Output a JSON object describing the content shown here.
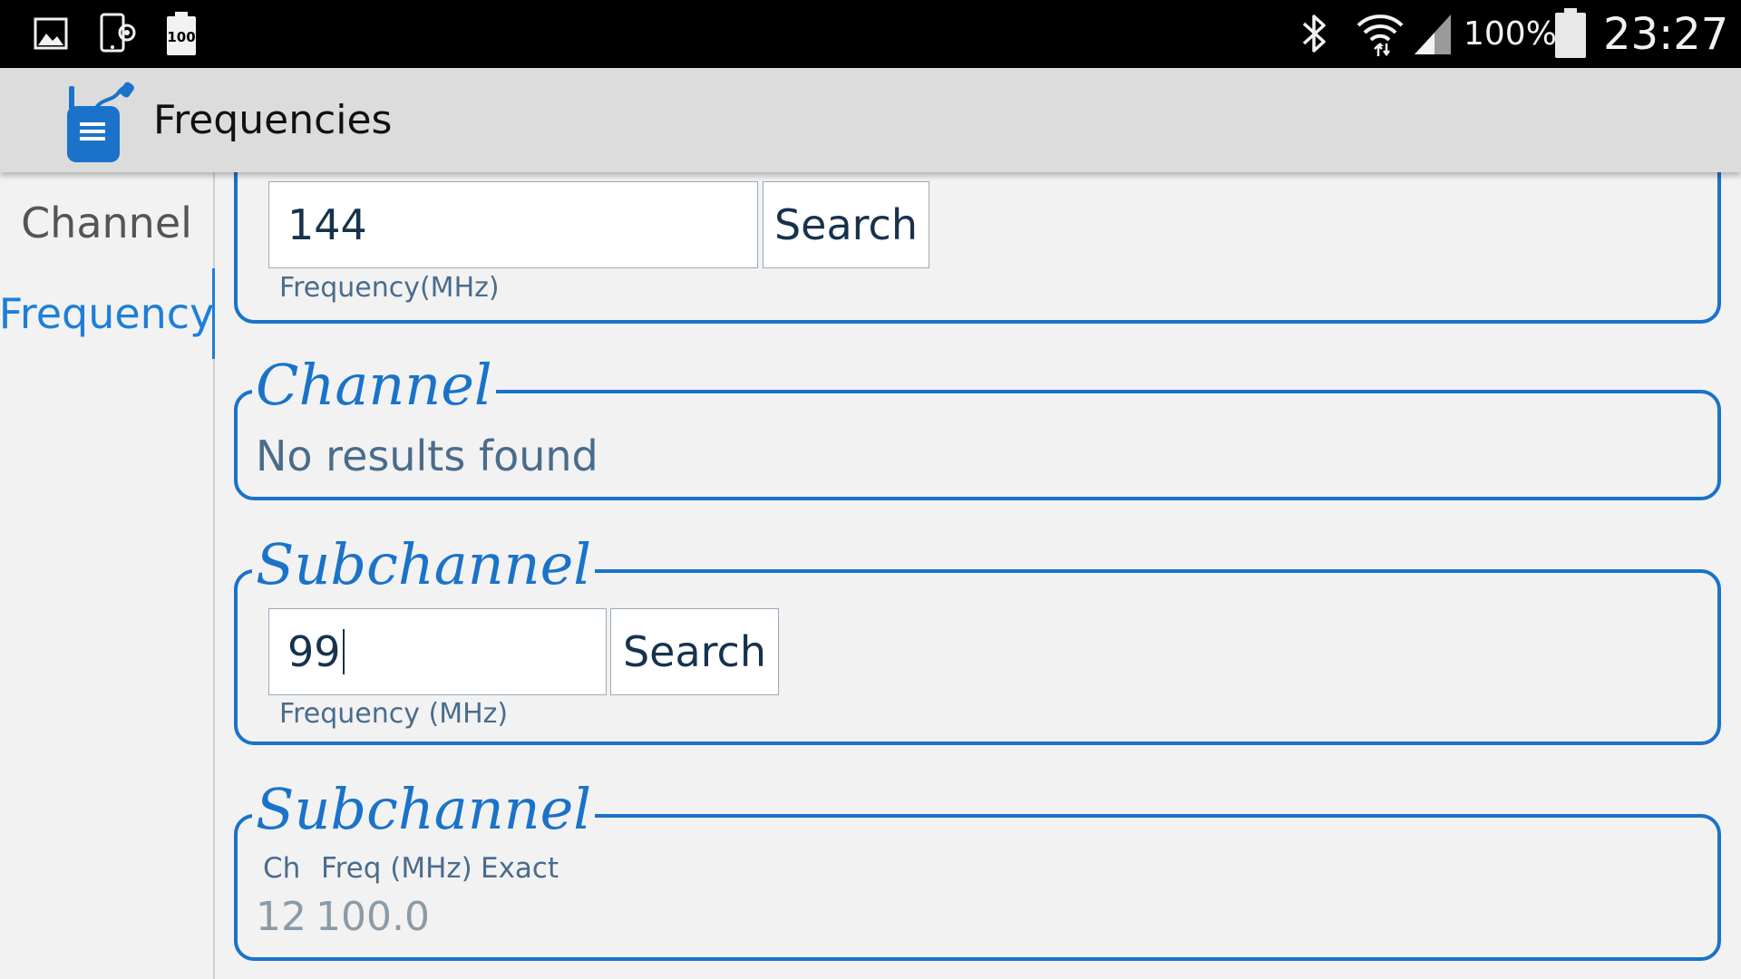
{
  "status_bar": {
    "icons": [
      "gallery-icon",
      "screen-settings-icon",
      "battery-100-notification-icon",
      "bluetooth-icon",
      "wifi-icon",
      "cell-signal-icon",
      "battery-icon"
    ],
    "battery_notice": "100",
    "battery_percent": "100%",
    "time": "23:27"
  },
  "app_bar": {
    "title": "Frequencies",
    "icon": "walkie-talkie-icon"
  },
  "tabs": [
    {
      "label": "Channel",
      "active": false
    },
    {
      "label": "Frequency",
      "active": true
    }
  ],
  "frequency_search": {
    "value": "144",
    "button_label": "Search",
    "hint": "Frequency(MHz)"
  },
  "channel_results": {
    "legend": "Channel",
    "message": "No results found"
  },
  "subchannel_search": {
    "legend": "Subchannel",
    "value": "99",
    "button_label": "Search",
    "hint": "Frequency (MHz)"
  },
  "subchannel_results": {
    "legend": "Subchannel",
    "columns": [
      "Ch",
      "Freq (MHz)",
      "Exact"
    ],
    "rows": [
      {
        "ch": "12",
        "freq": "100.0"
      }
    ]
  },
  "colors": {
    "accent": "#1e7fd6",
    "panel_border": "#1a73c9",
    "background": "#f2f2f2",
    "app_bar": "#dcdcdc"
  }
}
